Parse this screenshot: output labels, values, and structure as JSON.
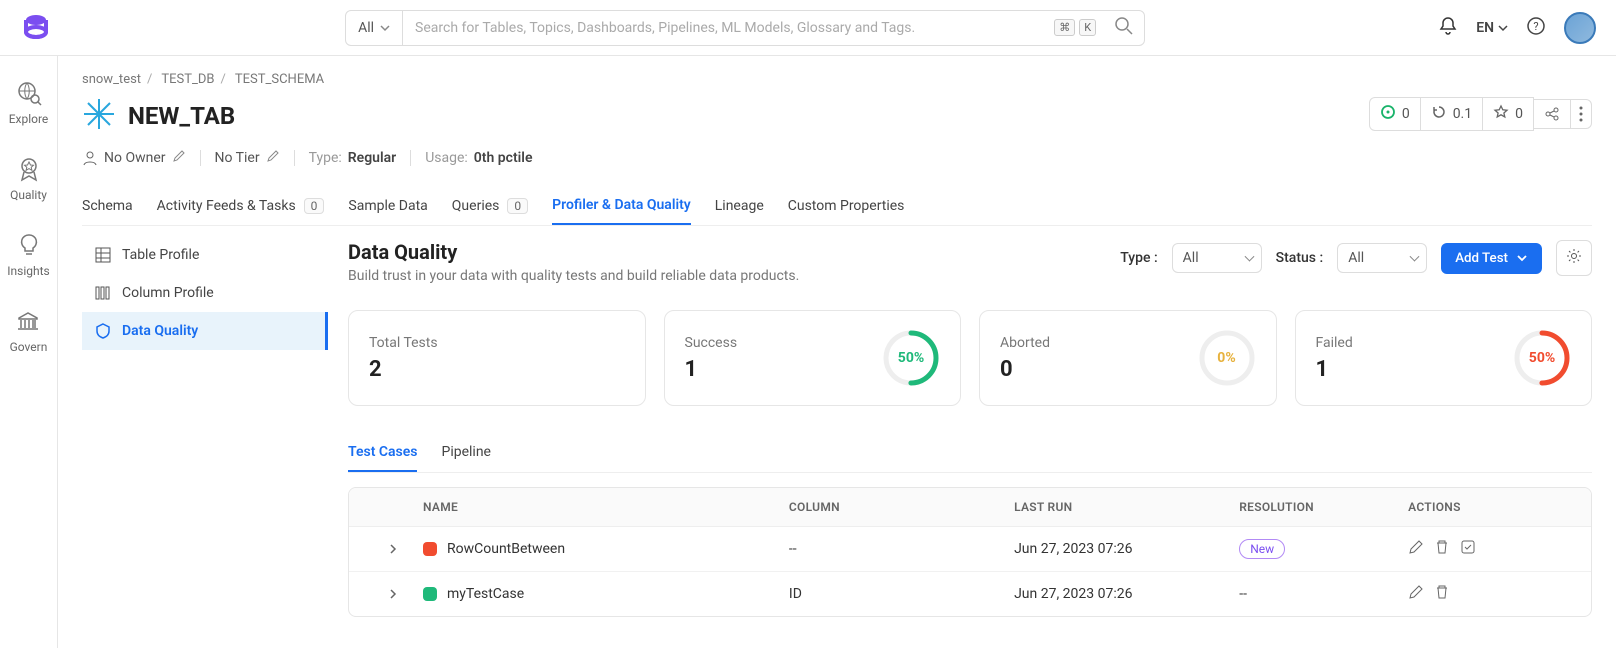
{
  "search": {
    "filter": "All",
    "placeholder": "Search for Tables, Topics, Dashboards, Pipelines, ML Models, Glossary and Tags.",
    "kbd1": "⌘",
    "kbd2": "K"
  },
  "lang": "EN",
  "sidebar": {
    "items": [
      {
        "label": "Explore"
      },
      {
        "label": "Quality"
      },
      {
        "label": "Insights"
      },
      {
        "label": "Govern"
      }
    ]
  },
  "breadcrumb": {
    "a": "snow_test",
    "b": "TEST_DB",
    "c": "TEST_SCHEMA"
  },
  "page": {
    "title": "NEW_TAB"
  },
  "header_actions": {
    "issues": "0",
    "version": "0.1",
    "stars": "0"
  },
  "meta": {
    "owner": "No Owner",
    "tier": "No Tier",
    "type_label": "Type:",
    "type_value": "Regular",
    "usage_label": "Usage:",
    "usage_value": "0th pctile"
  },
  "tabs": {
    "schema": "Schema",
    "activity": "Activity Feeds & Tasks",
    "activity_badge": "0",
    "sample": "Sample Data",
    "queries": "Queries",
    "queries_badge": "0",
    "profiler": "Profiler & Data Quality",
    "lineage": "Lineage",
    "custom": "Custom Properties"
  },
  "left_panel": {
    "table_profile": "Table Profile",
    "column_profile": "Column Profile",
    "data_quality": "Data Quality"
  },
  "dq": {
    "title": "Data Quality",
    "subtitle": "Build trust in your data with quality tests and build reliable data products.",
    "type_label": "Type :",
    "type_value": "All",
    "status_label": "Status :",
    "status_value": "All",
    "add_btn": "Add Test"
  },
  "stats": {
    "total": {
      "label": "Total Tests",
      "value": "2"
    },
    "success": {
      "label": "Success",
      "value": "1",
      "pct": "50%"
    },
    "aborted": {
      "label": "Aborted",
      "value": "0",
      "pct": "0%"
    },
    "failed": {
      "label": "Failed",
      "value": "1",
      "pct": "50%"
    }
  },
  "subtabs": {
    "test_cases": "Test Cases",
    "pipeline": "Pipeline"
  },
  "table": {
    "headers": {
      "name": "NAME",
      "column": "COLUMN",
      "last_run": "LAST RUN",
      "resolution": "RESOLUTION",
      "actions": "ACTIONS"
    },
    "rows": [
      {
        "name": "RowCountBetween",
        "column": "--",
        "last_run": "Jun 27, 2023 07:26",
        "resolution": "New",
        "status": "red",
        "deletable": true,
        "checkable": true
      },
      {
        "name": "myTestCase",
        "column": "ID",
        "last_run": "Jun 27, 2023 07:26",
        "resolution": "--",
        "status": "green",
        "deletable": true,
        "checkable": false
      }
    ]
  }
}
